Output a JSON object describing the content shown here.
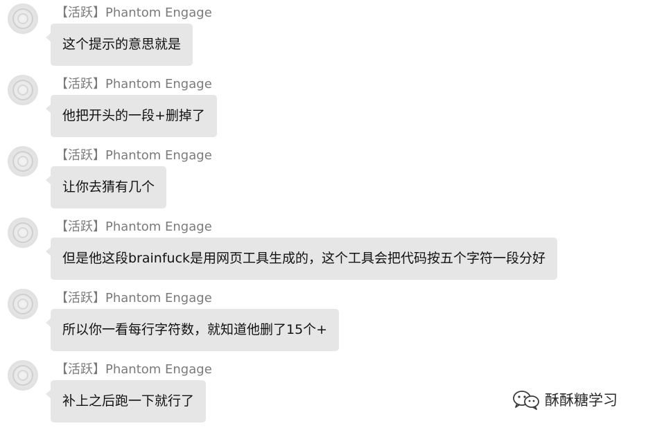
{
  "messages": [
    {
      "sender": "【活跃】Phantom Engage",
      "text": "这个提示的意思就是"
    },
    {
      "sender": "【活跃】Phantom Engage",
      "text": "他把开头的一段+删掉了"
    },
    {
      "sender": "【活跃】Phantom Engage",
      "text": "让你去猜有几个"
    },
    {
      "sender": "【活跃】Phantom Engage",
      "text": "但是他这段brainfuck是用网页工具生成的，这个工具会把代码按五个字符一段分好"
    },
    {
      "sender": "【活跃】Phantom Engage",
      "text": "所以你一看每行字符数，就知道他删了15个+"
    },
    {
      "sender": "【活跃】Phantom Engage",
      "text": "补上之后跑一下就行了"
    }
  ],
  "watermark": {
    "text": "酥酥糖学习",
    "icon": "wechat-icon"
  },
  "colors": {
    "bubble": "#e6e6e6",
    "sender": "#7a7a7a",
    "text": "#111111"
  }
}
